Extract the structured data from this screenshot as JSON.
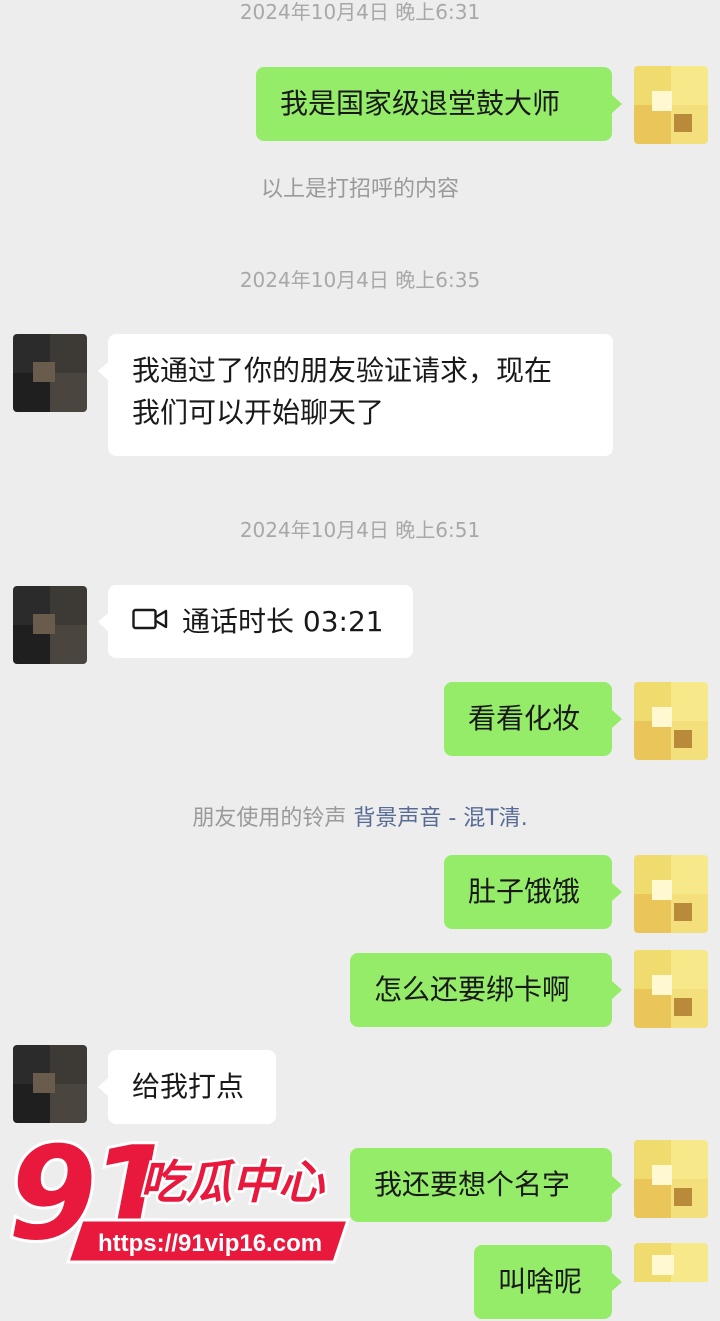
{
  "timestamps": [
    "2024年10月4日 晚上6:31",
    "2024年10月4日 晚上6:35",
    "2024年10月4日 晚上6:51"
  ],
  "messages": {
    "m1": "我是国家级退堂鼓大师",
    "sys1": "以上是打招呼的内容",
    "m2_line1": "我通过了你的朋友验证请求，现在",
    "m2_line2": "我们可以开始聊天了",
    "call_label": "通话时长 03:21",
    "m3": "看看化妆",
    "ring_prefix": "朋友使用的铃声",
    "ring_link": "背景声音 - 混T清.",
    "m4": "肚子饿饿",
    "m5": "怎么还要绑卡啊",
    "m6": "给我打点",
    "m7": "我还要想个名字",
    "m8": "叫啥呢"
  },
  "watermark": {
    "number": "91",
    "name": "吃瓜中心",
    "url": "https://91vip16.com"
  },
  "colors": {
    "background": "#ededed",
    "my_bubble": "#95ec69",
    "their_bubble": "#ffffff",
    "link": "#576b95",
    "watermark_red": "#e8193c"
  }
}
